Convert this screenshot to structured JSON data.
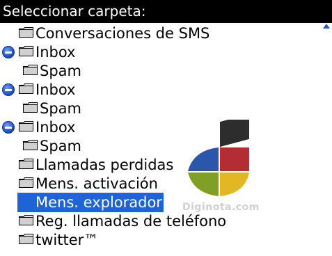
{
  "header": {
    "title": "Seleccionar carpeta:"
  },
  "folders": [
    {
      "label": "Conversaciones de SMS",
      "indent": 0,
      "collapse": false,
      "selected": false
    },
    {
      "label": "Inbox",
      "indent": 0,
      "collapse": true,
      "selected": false
    },
    {
      "label": "Spam",
      "indent": 1,
      "collapse": false,
      "selected": false
    },
    {
      "label": "Inbox",
      "indent": 0,
      "collapse": true,
      "selected": false
    },
    {
      "label": "Spam",
      "indent": 1,
      "collapse": false,
      "selected": false
    },
    {
      "label": "Inbox",
      "indent": 0,
      "collapse": true,
      "selected": false
    },
    {
      "label": "Spam",
      "indent": 1,
      "collapse": false,
      "selected": false
    },
    {
      "label": "Llamadas perdidas",
      "indent": 0,
      "collapse": false,
      "selected": false
    },
    {
      "label": "Mens. activación",
      "indent": 0,
      "collapse": false,
      "selected": false
    },
    {
      "label": "Mens. explorador",
      "indent": 0,
      "collapse": false,
      "selected": true
    },
    {
      "label": "Reg. llamadas de teléfono",
      "indent": 0,
      "collapse": false,
      "selected": false
    },
    {
      "label": "twitter™",
      "indent": 0,
      "collapse": false,
      "selected": false
    }
  ],
  "icons": {
    "folder": "folder-icon",
    "collapse": "collapse-minus-icon",
    "scroll": "scroll-up-arrow-icon"
  },
  "colors": {
    "selection": "#1f64d6",
    "title_bg": "#000000",
    "title_fg": "#ffffff"
  },
  "watermark": {
    "text": "Diginota.com"
  }
}
